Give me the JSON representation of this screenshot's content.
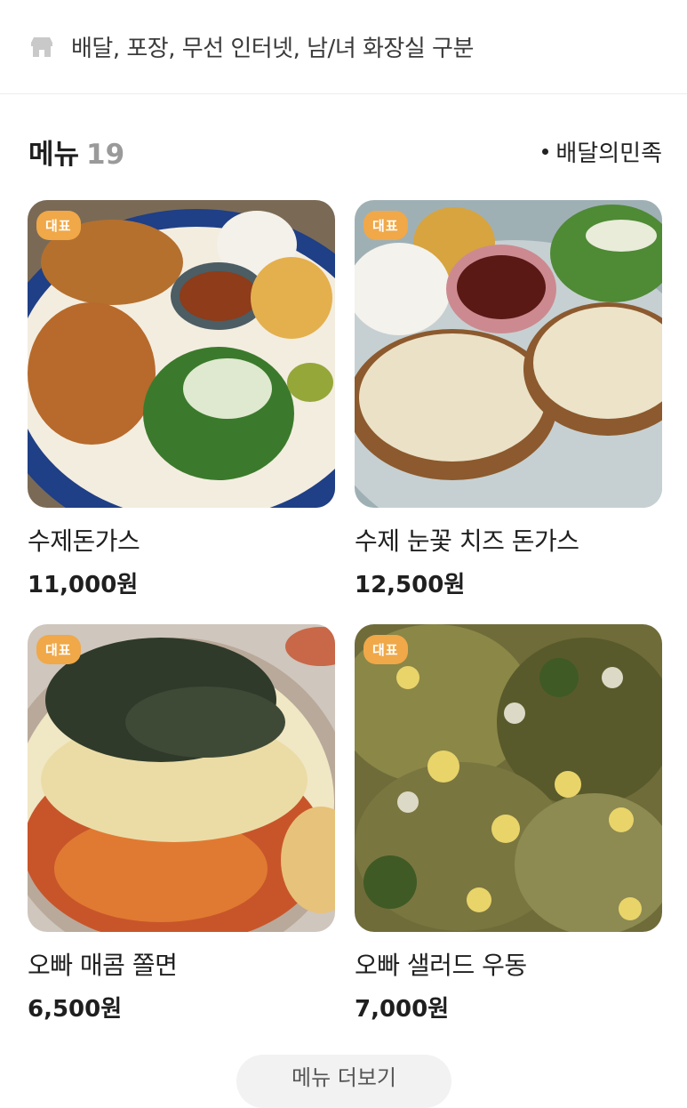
{
  "amenities": {
    "icon": "store-icon",
    "text": "배달, 포장, 무선 인터넷, 남/녀 화장실 구분"
  },
  "menu": {
    "title": "메뉴",
    "count": "19",
    "source": "배달의민족",
    "badge_label": "대표",
    "items": [
      {
        "name": "수제돈가스",
        "price": "11,000원",
        "badge": "대표"
      },
      {
        "name": "수제 눈꽃 치즈 돈가스",
        "price": "12,500원",
        "badge": "대표"
      },
      {
        "name": "오빠 매콤 쫄면",
        "price": "6,500원",
        "badge": "대표"
      },
      {
        "name": "오빠 샐러드 우동",
        "price": "7,000원",
        "badge": "대표"
      }
    ],
    "more_label": "메뉴 더보기"
  },
  "colors": {
    "badge": "#f0a848",
    "divider": "#ececec",
    "count": "#9a9a9a"
  }
}
